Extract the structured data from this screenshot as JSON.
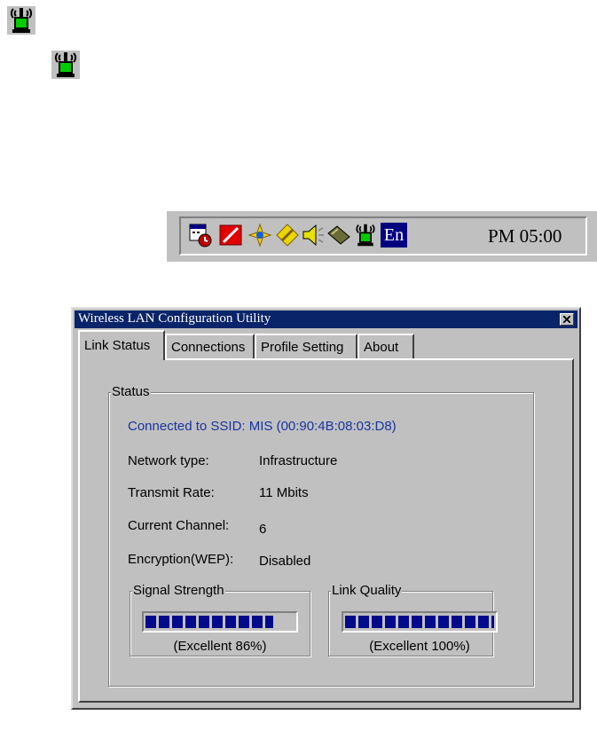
{
  "tray_icons_standalone": [
    {
      "icon": "wireless-antenna-icon",
      "colors": {
        "antenna": "#000000",
        "screen": "#00cc00"
      }
    },
    {
      "icon": "wireless-antenna-icon",
      "colors": {
        "antenna": "#000000",
        "screen": "#00cc00"
      }
    }
  ],
  "taskbar": {
    "icons": [
      "scheduler-icon",
      "red-slash-icon",
      "network-compass-icon",
      "pencil-diamond-icon",
      "speaker-icon",
      "pcmcia-card-icon",
      "wireless-antenna-icon"
    ],
    "language_indicator": "En",
    "clock": "PM 05:00"
  },
  "window": {
    "title": "Wireless LAN Configuration Utility",
    "tabs": [
      {
        "label": "Link Status",
        "active": true
      },
      {
        "label": "Connections",
        "active": false
      },
      {
        "label": "Profile Setting",
        "active": false
      },
      {
        "label": "About",
        "active": false
      }
    ],
    "status": {
      "group_label": "Status",
      "connected_line": "Connected to SSID: MIS (00:90:4B:08:03:D8)",
      "fields": [
        {
          "label": "Network type:",
          "value": "Infrastructure"
        },
        {
          "label": "Transmit Rate:",
          "value": "11 Mbits"
        },
        {
          "label": "Current Channel:",
          "value": "6"
        },
        {
          "label": "Encryption(WEP):",
          "value": "Disabled"
        }
      ]
    },
    "signal_strength": {
      "label": "Signal Strength",
      "caption": "(Excellent 86%)",
      "level": 0.86
    },
    "link_quality": {
      "label": "Link Quality",
      "caption": "(Excellent 100%)",
      "level": 1.0
    }
  },
  "colors": {
    "titlebar": "#0a246a",
    "meter_fill": "#000a8a",
    "ssid_text": "#1a33a0",
    "face": "#c0c0c0"
  }
}
